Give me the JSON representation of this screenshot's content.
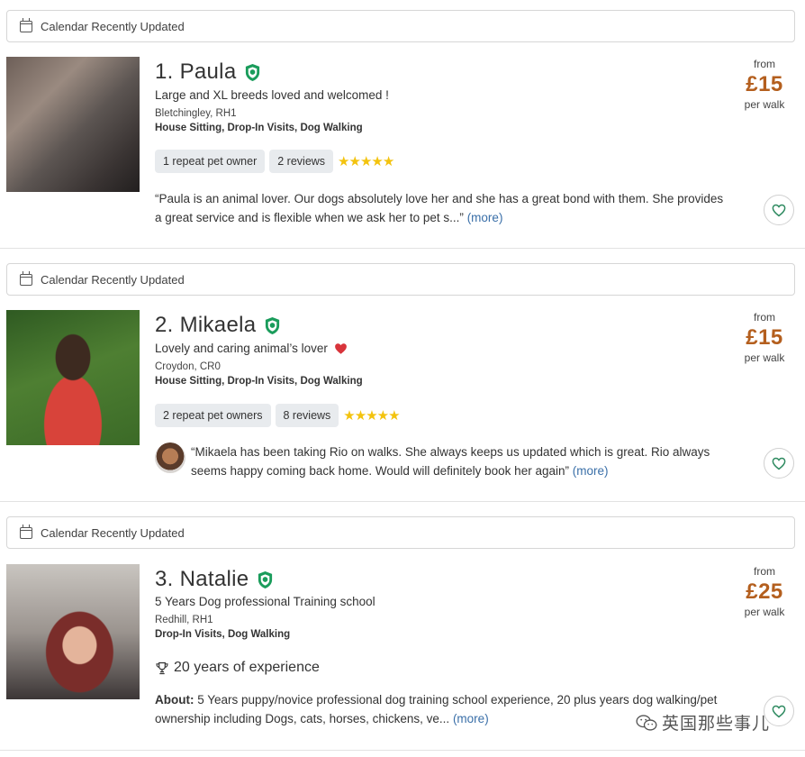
{
  "listings": [
    {
      "calendar_label": "Calendar Recently Updated",
      "name": "1. Paula",
      "tagline": "Large and XL breeds loved and welcomed !",
      "location": "Bletchingley, RH1",
      "services": "House Sitting, Drop-In Visits, Dog Walking",
      "repeat_owners": "1 repeat pet owner",
      "reviews": "2 reviews",
      "stars": "★★★★★",
      "review_text": "“Paula is an animal lover. Our dogs absolutely love her and she has a great bond with them. She provides a great service and is flexible when we ask her to pet s...”",
      "more": "(more)",
      "price_from": "from",
      "price": "£15",
      "price_unit": "per walk"
    },
    {
      "calendar_label": "Calendar Recently Updated",
      "name": "2. Mikaela",
      "tagline": "Lovely and caring animal’s lover",
      "location": "Croydon, CR0",
      "services": "House Sitting, Drop-In Visits, Dog Walking",
      "repeat_owners": "2 repeat pet owners",
      "reviews": "8 reviews",
      "stars": "★★★★★",
      "review_text": "“Mikaela has been taking Rio on walks. She always keeps us updated which is great. Rio always seems happy coming back home. Would will definitely book her again”",
      "more": "(more)",
      "price_from": "from",
      "price": "£15",
      "price_unit": "per walk"
    },
    {
      "calendar_label": "Calendar Recently Updated",
      "name": "3. Natalie",
      "tagline": "5 Years Dog professional Training school",
      "location": "Redhill, RH1",
      "services": "Drop-In Visits, Dog Walking",
      "experience": "20 years of experience",
      "about_label": "About:",
      "about_text": "5 Years puppy/novice professional dog training school experience, 20 plus years dog walking/pet ownership including Dogs, cats, horses, chickens, ve...",
      "more": "(more)",
      "price_from": "from",
      "price": "£25",
      "price_unit": "per walk"
    }
  ],
  "watermark": "英国那些事儿",
  "colors": {
    "price": "#b45f1e",
    "badge": "#1a9c5b",
    "star": "#f3c30e",
    "link": "#3a6fa8",
    "heart_emoji": "#d8343b"
  },
  "icons": [
    "calendar-icon",
    "shield-check-icon",
    "star-icon",
    "heart-icon",
    "trophy-icon",
    "wechat-icon"
  ]
}
